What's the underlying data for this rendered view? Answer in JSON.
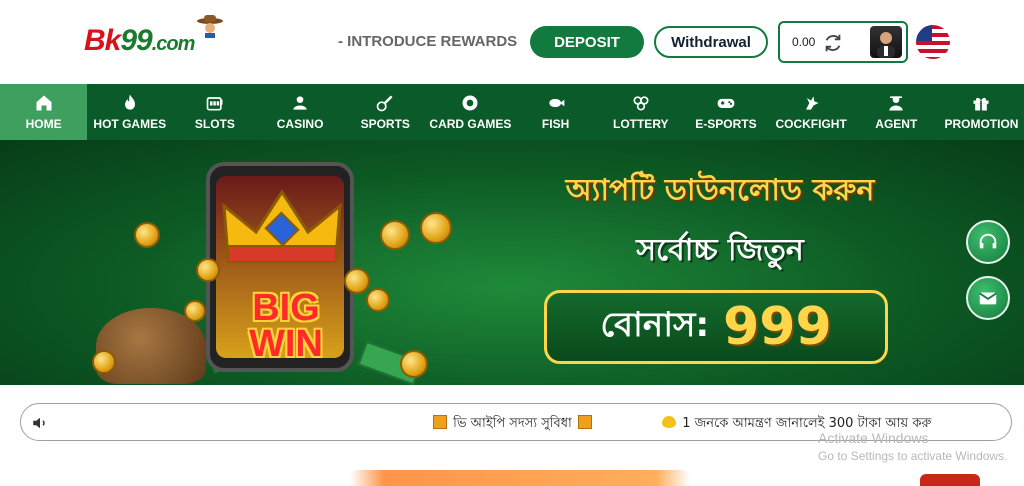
{
  "header": {
    "logo_text_a": "Bk",
    "logo_text_b": "99",
    "logo_text_c": ".com",
    "rewards_link": "- INTRODUCE REWARDS",
    "deposit_label": "DEPOSIT",
    "withdraw_label": "Withdrawal",
    "balance": "0.00",
    "language_icon": "us-flag-icon"
  },
  "nav": {
    "items": [
      {
        "label": "HOME",
        "icon": "home-icon"
      },
      {
        "label": "HOT GAMES",
        "icon": "fire-icon"
      },
      {
        "label": "SLOTS",
        "icon": "slot-machine-icon"
      },
      {
        "label": "CASINO",
        "icon": "casino-dealer-icon"
      },
      {
        "label": "SPORTS",
        "icon": "sports-icon"
      },
      {
        "label": "CARD GAMES",
        "icon": "poker-chip-icon"
      },
      {
        "label": "FISH",
        "icon": "fish-icon"
      },
      {
        "label": "LOTTERY",
        "icon": "lottery-balls-icon"
      },
      {
        "label": "E-SPORTS",
        "icon": "gamepad-icon"
      },
      {
        "label": "COCKFIGHT",
        "icon": "rooster-icon"
      },
      {
        "label": "AGENT",
        "icon": "agent-icon"
      },
      {
        "label": "PROMOTION",
        "icon": "gift-icon"
      }
    ],
    "active": "HOME",
    "active_color": "#3e9f5e",
    "bar_color": "#0b5a2a"
  },
  "banner": {
    "title": "অ্যাপটি ডাউনলোড করুন",
    "subtitle": "সর্বোচ্চ জিতুন",
    "bonus_label": "বোনাস:",
    "bonus_value": "999",
    "big_win_line1": "BIG",
    "big_win_line2": "WIN"
  },
  "ticker": {
    "item1": "ভি আইপি সদস্য সুবিধা",
    "item2": "1 জনকে আমন্ত্রণ জানালেই 300 টাকা আয় করু"
  },
  "os_watermark": {
    "line1": "Activate Windows",
    "line2": "Go to Settings to activate Windows."
  }
}
